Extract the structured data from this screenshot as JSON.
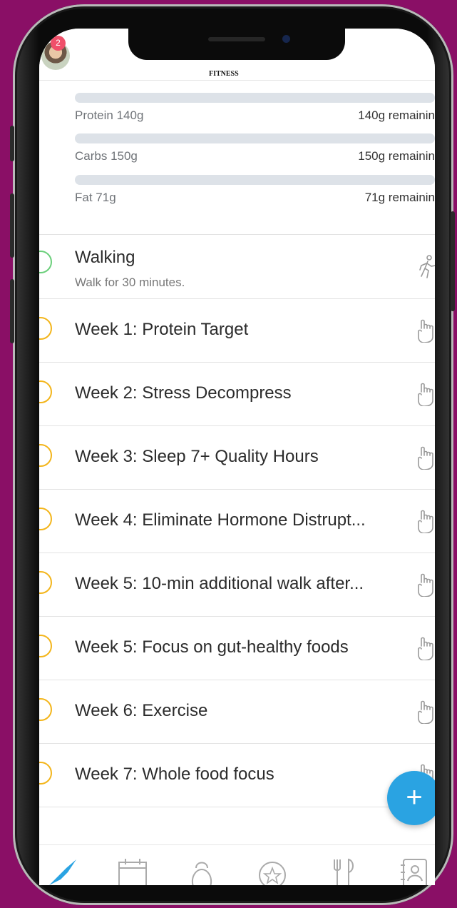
{
  "header": {
    "notification_count": "2",
    "logo_text": "FITNESS"
  },
  "macros": [
    {
      "label": "Protein 140g",
      "remaining": "140g remainin"
    },
    {
      "label": "Carbs 150g",
      "remaining": "150g remainin"
    },
    {
      "label": "Fat 71g",
      "remaining": "71g remainin"
    }
  ],
  "tasks": [
    {
      "title": "Walking",
      "subtitle": "Walk for 30 minutes.",
      "status_color": "#6bcf7b",
      "icon": "walking-icon"
    },
    {
      "title": "Week 1: Protein Target",
      "status_color": "#f3b51b",
      "icon": "finger-tap-icon"
    },
    {
      "title": "Week 2: Stress Decompress",
      "status_color": "#f3b51b",
      "icon": "finger-tap-icon"
    },
    {
      "title": "Week 3: Sleep 7+ Quality Hours",
      "status_color": "#f3b51b",
      "icon": "finger-tap-icon"
    },
    {
      "title": "Week 4: Eliminate Hormone Distrupt...",
      "status_color": "#f3b51b",
      "icon": "finger-tap-icon"
    },
    {
      "title": "Week 5: 10-min additional walk after...",
      "status_color": "#f3b51b",
      "icon": "finger-tap-icon"
    },
    {
      "title": "Week 5: Focus on gut-healthy foods",
      "status_color": "#f3b51b",
      "icon": "finger-tap-icon"
    },
    {
      "title": "Week 6: Exercise",
      "status_color": "#f3b51b",
      "icon": "finger-tap-icon"
    },
    {
      "title": "Week 7: Whole food focus",
      "status_color": "#f3b51b",
      "icon": "finger-tap-icon"
    }
  ],
  "fab": {
    "label": "+"
  },
  "tabs": [
    "rocket-icon",
    "calendar-icon",
    "kettlebell-icon",
    "star-badge-icon",
    "fork-knife-icon",
    "contacts-icon"
  ],
  "colors": {
    "background": "#8a0f66",
    "accent": "#2aa3e2",
    "pending": "#f3b51b",
    "done": "#6bcf7b"
  }
}
